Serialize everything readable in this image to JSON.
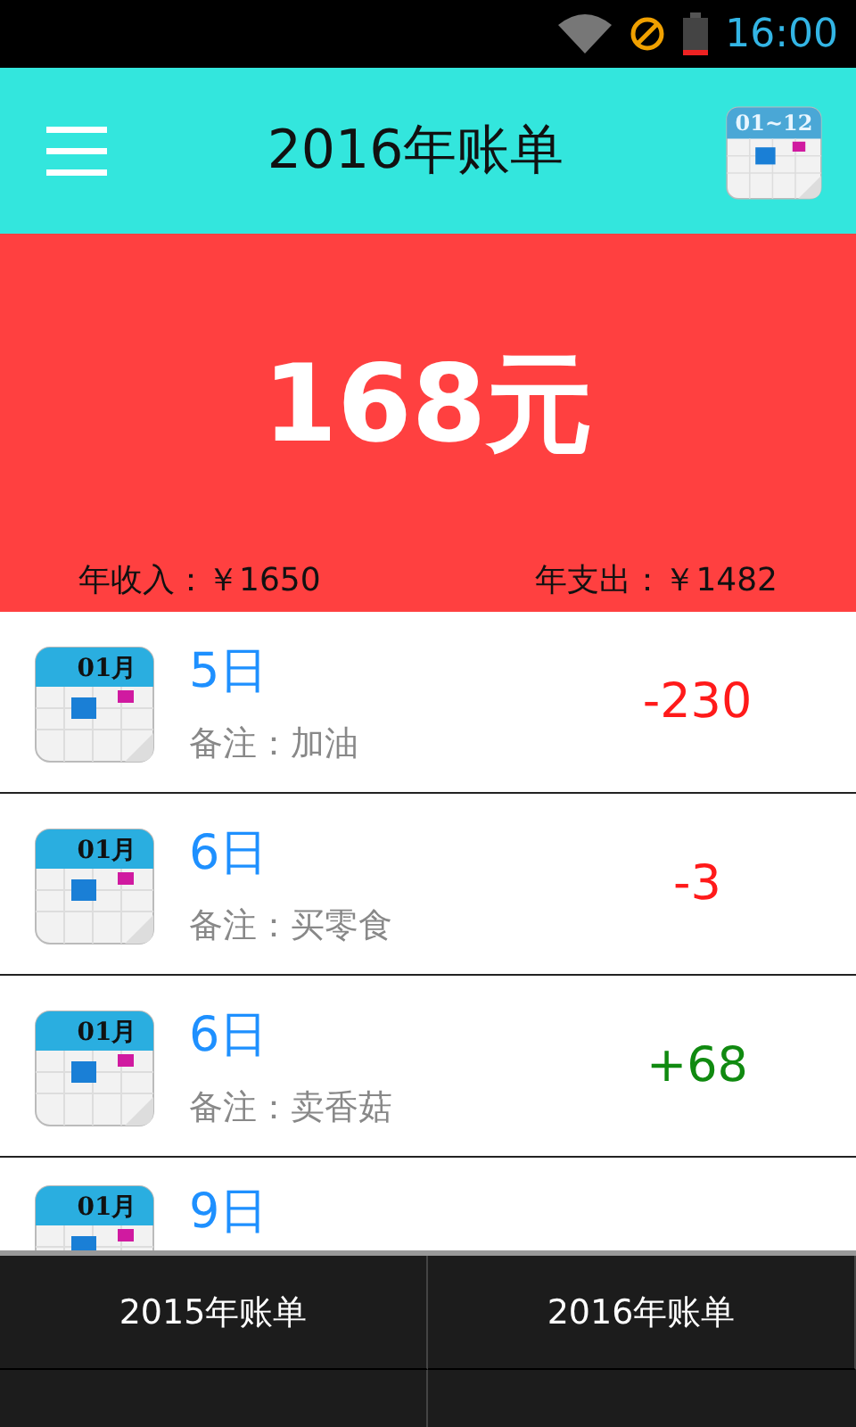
{
  "status_bar": {
    "time": "16:00"
  },
  "header": {
    "title": "2016年账单",
    "calendar_label": "01~12"
  },
  "summary": {
    "balance": "168元",
    "income": "年收入：￥1650",
    "expense": "年支出：￥1482"
  },
  "bills": [
    {
      "month": "01月",
      "day": "5日",
      "note": "备注：加油",
      "amount": "-230",
      "kind": "expense"
    },
    {
      "month": "01月",
      "day": "6日",
      "note": "备注：买零食",
      "amount": "-3",
      "kind": "expense"
    },
    {
      "month": "01月",
      "day": "6日",
      "note": "备注：卖香菇",
      "amount": "+68",
      "kind": "income"
    },
    {
      "month": "01月",
      "day": "9日"
    }
  ],
  "menu": {
    "items": [
      "2015年账单",
      "2016年账单"
    ]
  }
}
